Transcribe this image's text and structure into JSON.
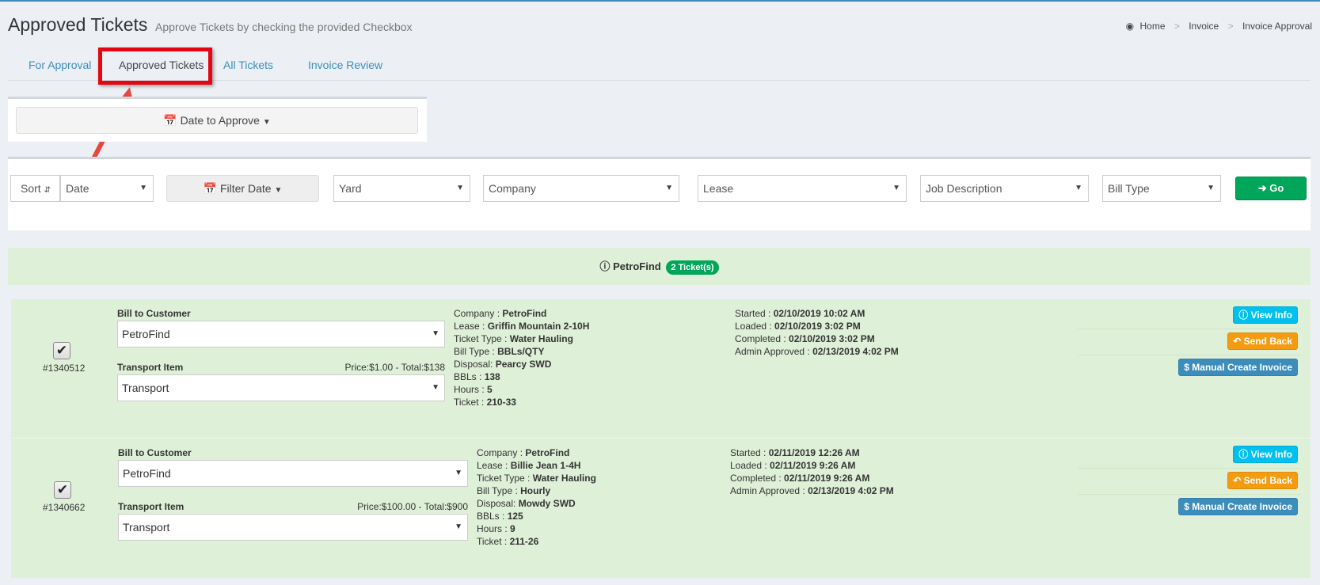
{
  "header": {
    "title": "Approved Tickets",
    "subtitle": "Approve Tickets by checking the provided Checkbox",
    "breadcrumb": [
      "Home",
      "Invoice",
      "Invoice Approval"
    ]
  },
  "tabs": [
    "For Approval",
    "Approved Tickets",
    "All Tickets",
    "Invoice Review"
  ],
  "active_tab": "Approved Tickets",
  "date_filter": {
    "label": "Date to Approve"
  },
  "filters": {
    "sort_label": "Sort",
    "sort_by": "Date",
    "filter_date_label": "Filter Date",
    "yard": "Yard",
    "company": "Company",
    "lease": "Lease",
    "job_description": "Job Description",
    "bill_type": "Bill Type",
    "go_label": "Go"
  },
  "group": {
    "company": "PetroFind",
    "count_badge": "2 Ticket(s)"
  },
  "labels": {
    "bill_to_customer": "Bill to Customer",
    "transport_item": "Transport Item",
    "view_info": "View Info",
    "send_back": "Send Back",
    "manual_create_invoice": "Manual Create Invoice"
  },
  "tickets": [
    {
      "id": "#1340512",
      "checked": true,
      "bill_to": "PetroFind",
      "transport": "Transport",
      "price": "Price:$1.00 - Total:$138",
      "company": "PetroFind",
      "lease": "Griffin Mountain 2-10H",
      "ticket_type": "Water Hauling",
      "bill_type": "BBLs/QTY",
      "disposal": "Pearcy SWD",
      "bbls": "138",
      "hours": "5",
      "ticket": "210-33",
      "started": "02/10/2019 10:02 AM",
      "loaded": "02/10/2019 3:02 PM",
      "completed": "02/10/2019 3:02 PM",
      "admin_approved": "02/13/2019 4:02 PM"
    },
    {
      "id": "#1340662",
      "checked": true,
      "bill_to": "PetroFind",
      "transport": "Transport",
      "price": "Price:$100.00 - Total:$900",
      "company": "PetroFind",
      "lease": "Billie Jean 1-4H",
      "ticket_type": "Water Hauling",
      "bill_type": "Hourly",
      "disposal": "Mowdy SWD",
      "bbls": "125",
      "hours": "9",
      "ticket": "211-26",
      "started": "02/11/2019 12:26 AM",
      "loaded": "02/11/2019 9:26 AM",
      "completed": "02/11/2019 9:26 AM",
      "admin_approved": "02/13/2019 4:02 PM"
    }
  ],
  "colors": {
    "accent": "#3c8dbc",
    "success": "#00a65a",
    "ticket_bg": "#dff0d8",
    "highlight": "#e30613"
  }
}
